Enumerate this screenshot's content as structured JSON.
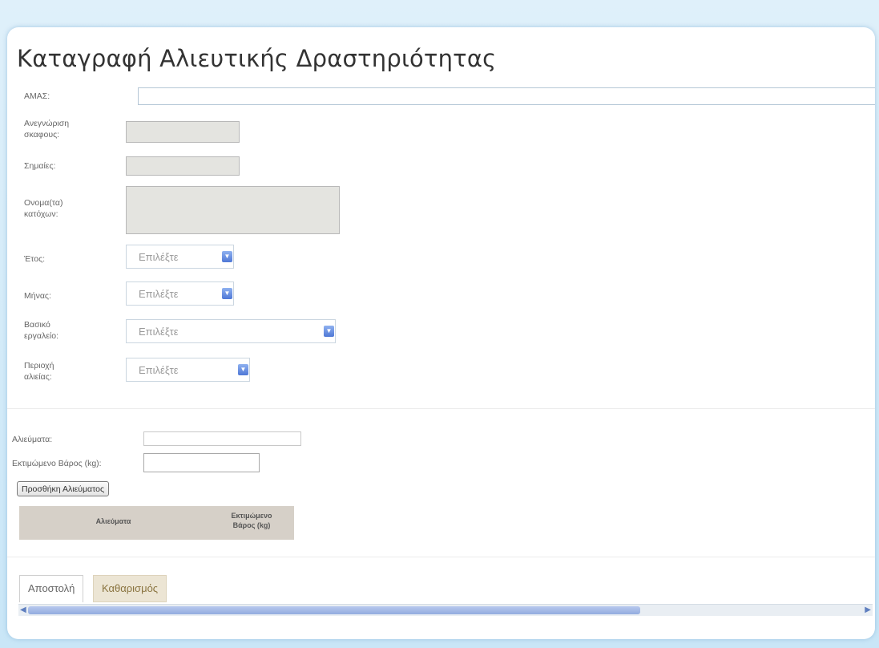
{
  "form": {
    "title": "Καταγραφή Αλιευτικής Δραστηριότητας",
    "labels": {
      "amas": "ΑΜΑΣ:",
      "vessel_line1": "Ανεγνώριση",
      "vessel_line2": "σκαφους:",
      "flag": "Σημαίες:",
      "owners_line1": "Ονομα(τα)",
      "owners_line2": "κατόχων:",
      "year": "Έτος:",
      "month": "Μήνας:",
      "gear_line1": "Βασικό",
      "gear_line2": "εργαλείο:",
      "area_line1": "Περιοχή",
      "area_line2": "αλιείας:"
    },
    "select_placeholder": "Επιλέξτε"
  },
  "catch": {
    "species_label": "Αλιεύματα:",
    "weight_label": "Εκτιμώμενο Βάρος (kg):",
    "add_button": "Προσθήκη Αλιεύματος",
    "grid_headers": [
      "Αλιεύματα",
      "Εκτιμώμενο",
      "Βάρος (kg)"
    ]
  },
  "tabs": {
    "send": "Αποστολή",
    "clear": "Καθαρισμός"
  }
}
